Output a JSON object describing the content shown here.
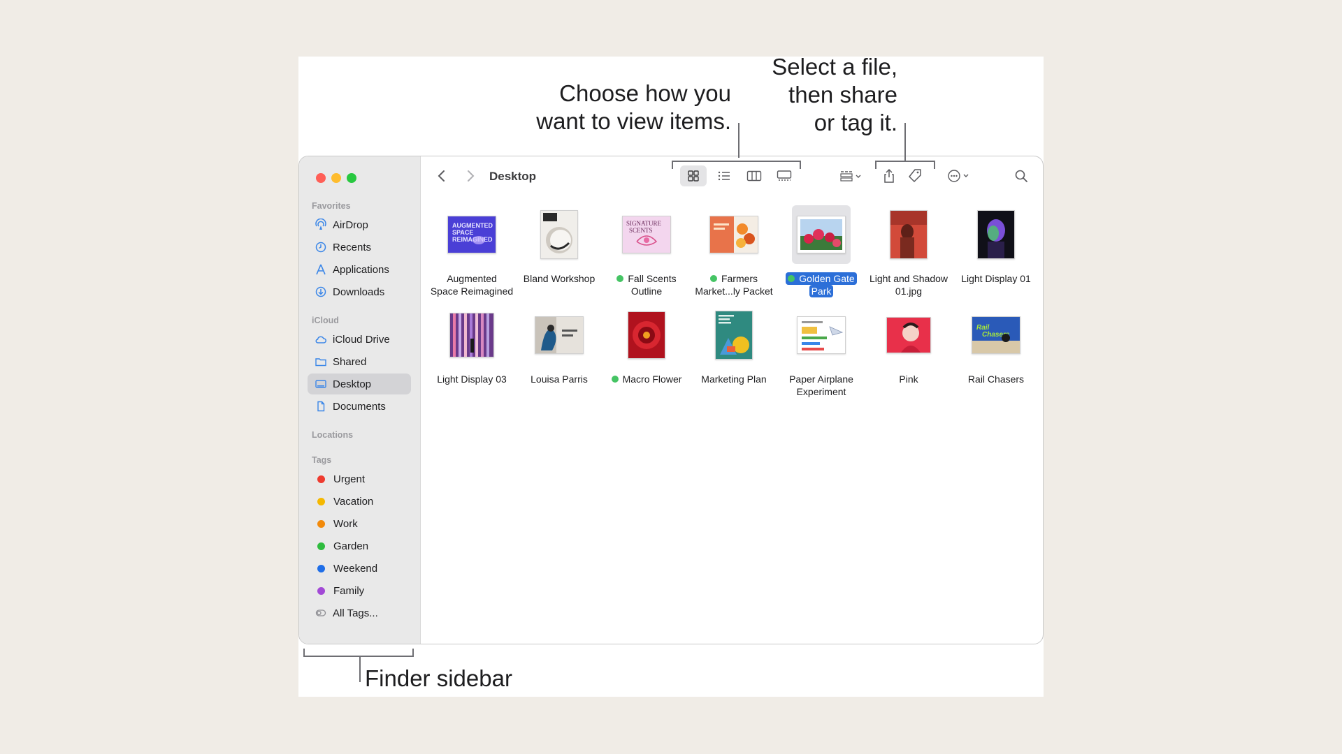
{
  "callouts": {
    "view_items": [
      "Choose how you",
      "want to view items."
    ],
    "share_tag": [
      "Select a file,",
      "then share",
      "or tag it."
    ],
    "sidebar": "Finder sidebar"
  },
  "window": {
    "title": "Desktop",
    "colors": {
      "close": "#ff5f57",
      "minimize": "#febc2e",
      "zoom": "#28c840",
      "selection": "#2c6fd8",
      "green_tag": "#45c464"
    }
  },
  "toolbar": {
    "icons": [
      "back-icon",
      "forward-icon",
      "icon-view-icon",
      "list-view-icon",
      "column-view-icon",
      "gallery-view-icon",
      "group-icon",
      "share-icon",
      "tag-icon",
      "more-icon",
      "search-icon"
    ],
    "selected_view": "icon-view"
  },
  "sidebar": {
    "favorites_label": "Favorites",
    "favorites": [
      {
        "label": "AirDrop",
        "icon": "airdrop-icon"
      },
      {
        "label": "Recents",
        "icon": "clock-icon"
      },
      {
        "label": "Applications",
        "icon": "applications-icon"
      },
      {
        "label": "Downloads",
        "icon": "download-icon"
      }
    ],
    "icloud_label": "iCloud",
    "icloud": [
      {
        "label": "iCloud Drive",
        "icon": "cloud-icon"
      },
      {
        "label": "Shared",
        "icon": "shared-folder-icon"
      },
      {
        "label": "Desktop",
        "icon": "desktop-icon",
        "selected": true
      },
      {
        "label": "Documents",
        "icon": "document-icon"
      }
    ],
    "locations_label": "Locations",
    "tags_label": "Tags",
    "tags": [
      {
        "label": "Urgent",
        "color": "#ee3b2f"
      },
      {
        "label": "Vacation",
        "color": "#f5b800"
      },
      {
        "label": "Work",
        "color": "#f28a0b"
      },
      {
        "label": "Garden",
        "color": "#2fbc3f"
      },
      {
        "label": "Weekend",
        "color": "#1f6ee8"
      },
      {
        "label": "Family",
        "color": "#a249d6"
      }
    ],
    "all_tags": "All Tags..."
  },
  "files": [
    {
      "name": [
        "Augmented",
        "Space Reimagined"
      ],
      "tag": false
    },
    {
      "name": [
        "Bland Workshop"
      ],
      "tag": false
    },
    {
      "name": [
        "Fall Scents",
        "Outline"
      ],
      "tag": true
    },
    {
      "name": [
        "Farmers",
        "Market...ly Packet"
      ],
      "tag": true
    },
    {
      "name": [
        "Golden Gate",
        "Park"
      ],
      "tag": true,
      "selected": true
    },
    {
      "name": [
        "Light and Shadow",
        "01.jpg"
      ],
      "tag": false
    },
    {
      "name": [
        "Light Display 01"
      ],
      "tag": false
    },
    {
      "name": [
        "Light Display 03"
      ],
      "tag": false
    },
    {
      "name": [
        "Louisa Parris"
      ],
      "tag": false
    },
    {
      "name": [
        "Macro Flower"
      ],
      "tag": true
    },
    {
      "name": [
        "Marketing Plan"
      ],
      "tag": false
    },
    {
      "name": [
        "Paper Airplane",
        "Experiment"
      ],
      "tag": false
    },
    {
      "name": [
        "Pink"
      ],
      "tag": false
    },
    {
      "name": [
        "Rail Chasers"
      ],
      "tag": false
    }
  ]
}
